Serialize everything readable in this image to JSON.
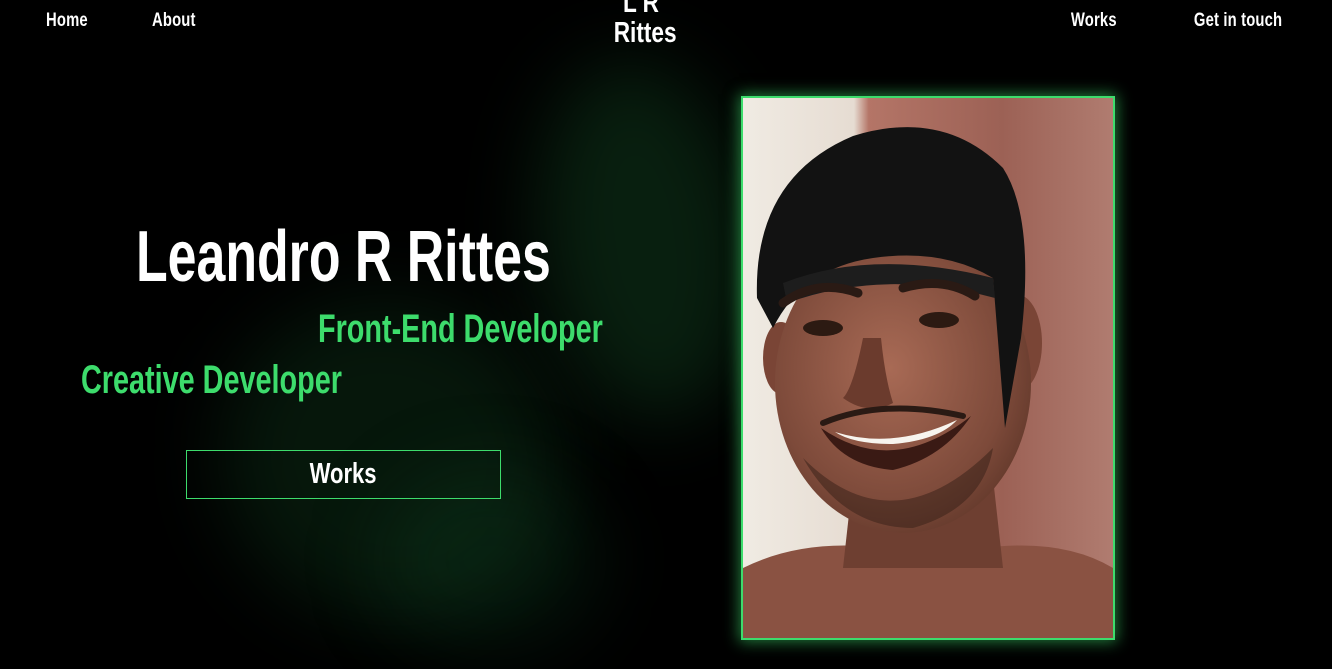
{
  "nav": {
    "left": [
      {
        "label": "Home"
      },
      {
        "label": "About"
      }
    ],
    "right": [
      {
        "label": "Works"
      },
      {
        "label": "Get in touch"
      }
    ]
  },
  "logo": {
    "line1": "L R",
    "line2": "Rittes"
  },
  "hero": {
    "name": "Leandro R Rittes",
    "roles": [
      "Front-End Developer",
      "Creative Developer"
    ],
    "button_label": "Works"
  },
  "colors": {
    "background": "#000000",
    "accent": "#3ddc6c",
    "text": "#ffffff"
  }
}
